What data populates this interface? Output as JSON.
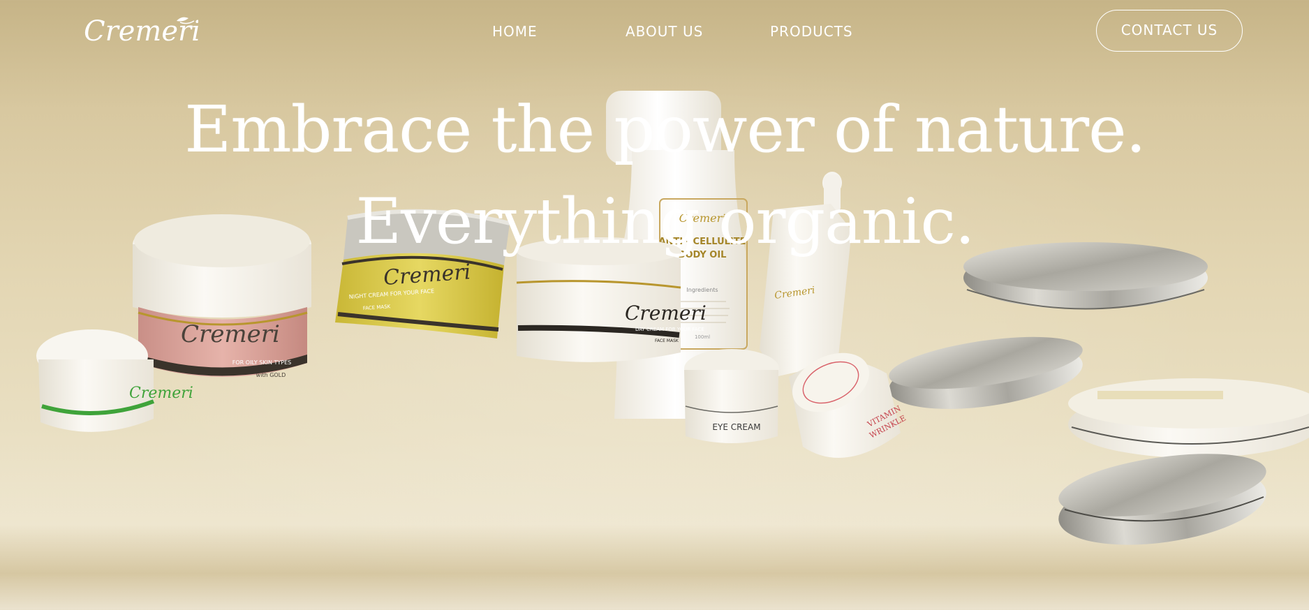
{
  "brand": {
    "logo_text": "Cremeri"
  },
  "nav": {
    "links": [
      "HOME",
      "ABOUT US",
      "PRODUCTS"
    ],
    "cta": "CONTACT US"
  },
  "hero": {
    "headline": "Embrace the power of nature.",
    "subheadline": "Everything organic."
  },
  "products": {
    "body_oil": {
      "brand": "Cremeri",
      "name_line1": "ANTI - CELLULITE",
      "name_line2": "BODY OIL",
      "ingredients_title": "Ingredients",
      "volume": "100ml"
    },
    "face_mask": {
      "brand": "Cremeri",
      "band": "NIGHT CREAM FOR YOUR FACE",
      "sub": "FACE MASK"
    },
    "day_cream": {
      "brand": "Cremeri",
      "band": "DAY CREAM FOR YOUR FACE",
      "sub": "FACE MASK"
    },
    "pink_jar": {
      "brand": "Cremeri",
      "band": "FOR OILY SKIN TYPES",
      "sub": "with GOLD"
    },
    "eye_cream": {
      "label": "EYE CREAM"
    },
    "vitamin_jar": {
      "label_line1": "VITAMIN",
      "label_line2": "WRINKLE"
    },
    "serum": {
      "brand": "Cremeri"
    }
  },
  "colors": {
    "text": "#ffffff",
    "pink": "#d9a39c",
    "yellow": "#d9c94a",
    "gold": "#b8962e",
    "green": "#3fa33a",
    "silver": "#b9b8b1"
  }
}
